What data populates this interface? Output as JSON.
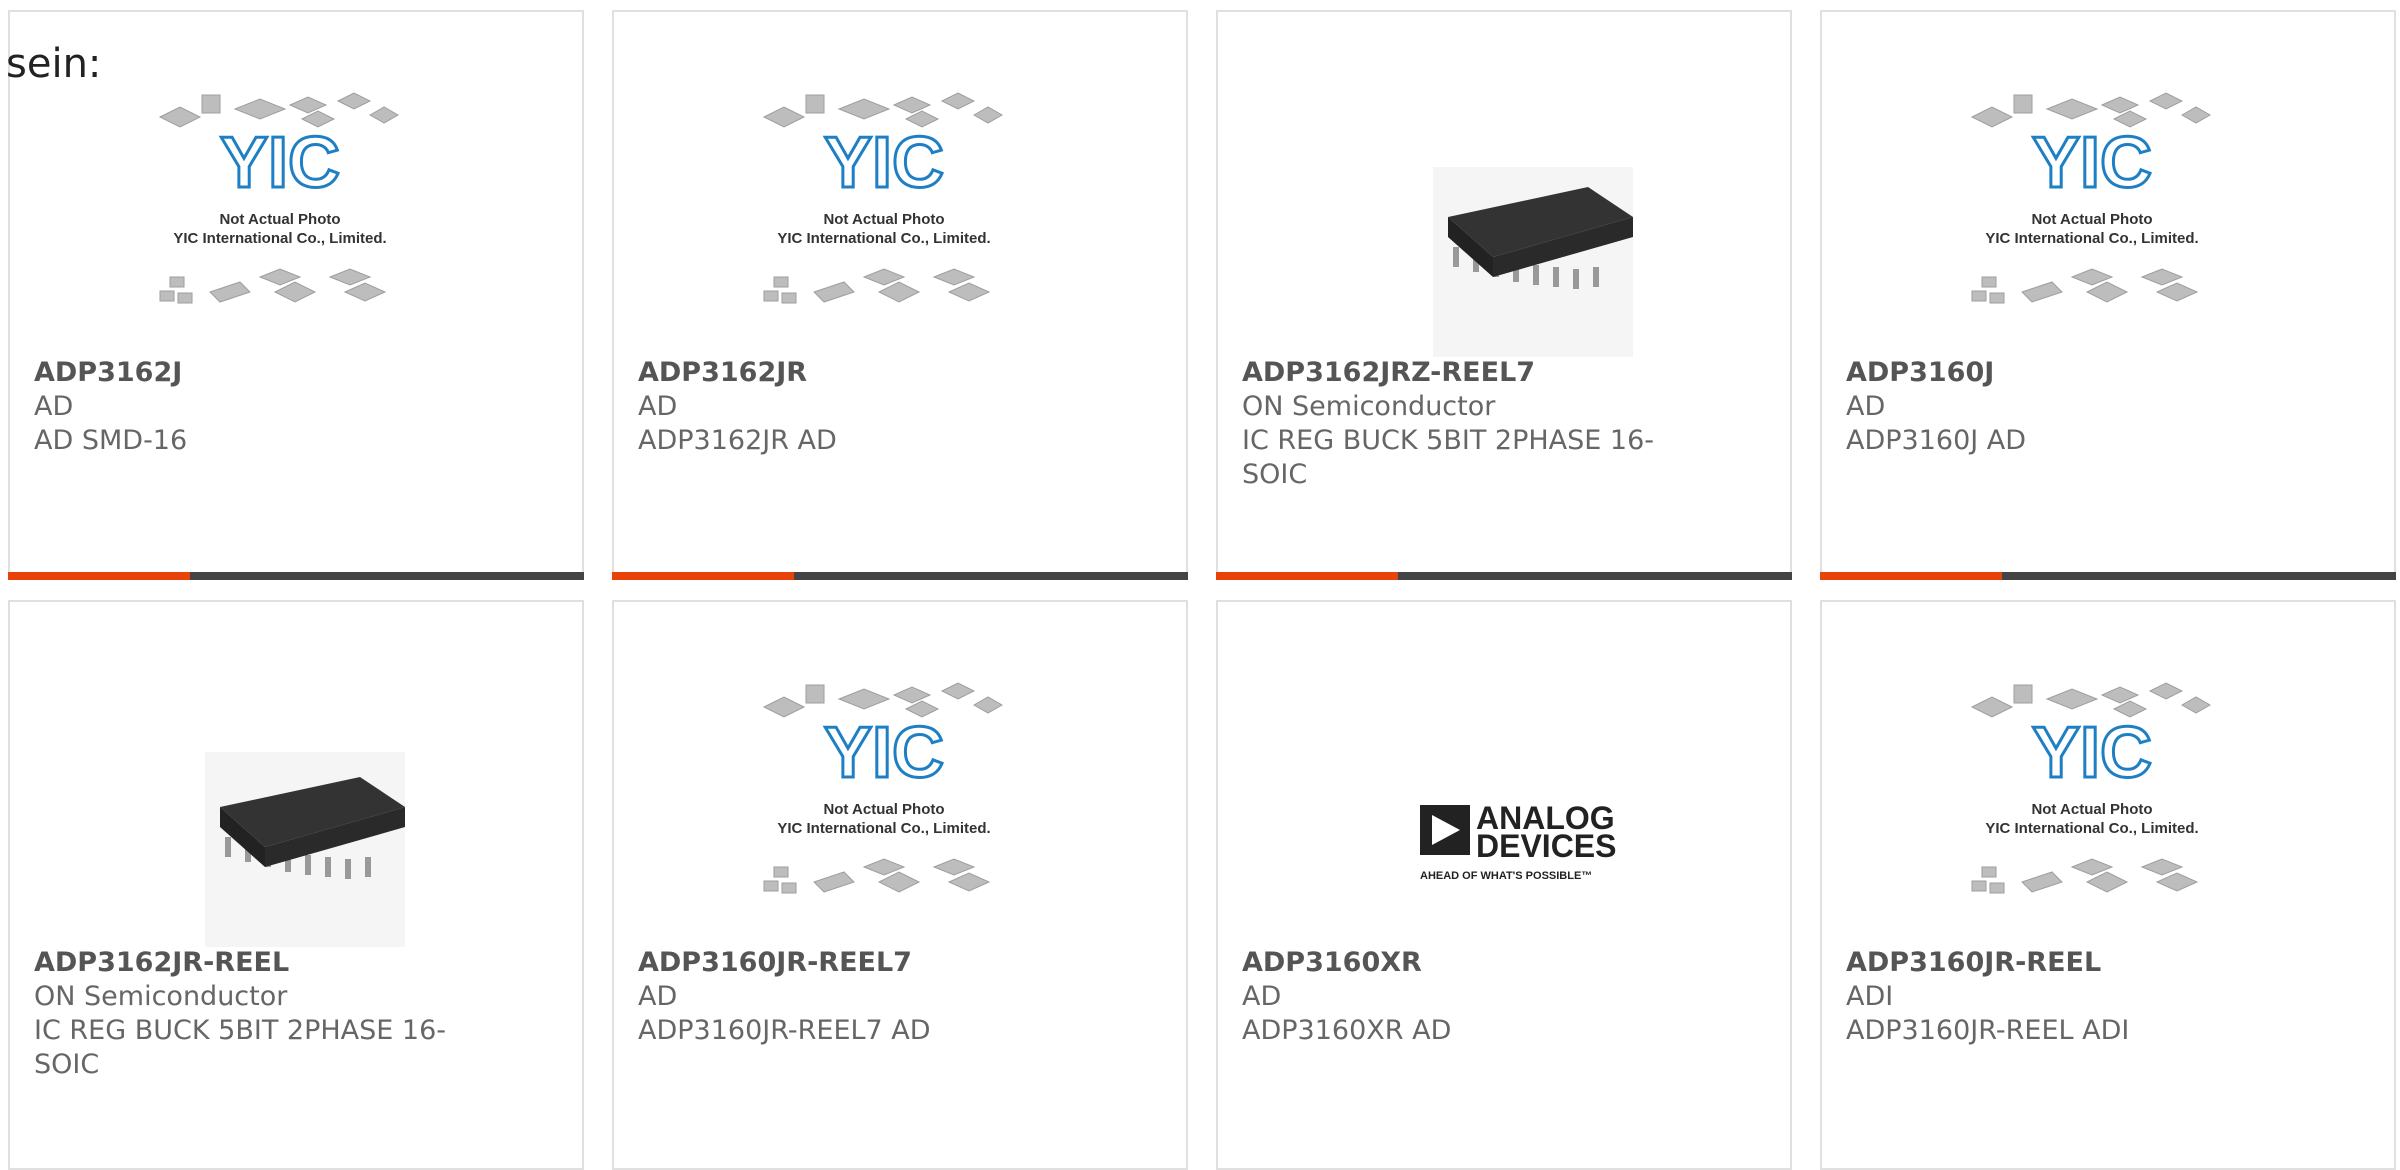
{
  "heading": "sein:",
  "brand": {
    "accent": "#e8410a",
    "bar": "#444444"
  },
  "products": [
    {
      "part_number": "ADP3162J",
      "manufacturer": "AD",
      "description": "AD SMD-16",
      "image": "yic-placeholder-image"
    },
    {
      "part_number": "ADP3162JR",
      "manufacturer": "AD",
      "description": "ADP3162JR AD",
      "image": "yic-placeholder-image"
    },
    {
      "part_number": "ADP3162JRZ-REEL7",
      "manufacturer": "ON Semiconductor",
      "description": "IC REG BUCK 5BIT 2PHASE 16-SOIC",
      "image": "soic-chip-image"
    },
    {
      "part_number": "ADP3160J",
      "manufacturer": "AD",
      "description": "ADP3160J AD",
      "image": "yic-placeholder-image"
    },
    {
      "part_number": "ADP3162JR-REEL",
      "manufacturer": "ON Semiconductor",
      "description": "IC REG BUCK 5BIT 2PHASE 16-SOIC",
      "image": "soic-chip-image"
    },
    {
      "part_number": "ADP3160JR-REEL7",
      "manufacturer": "AD",
      "description": "ADP3160JR-REEL7 AD",
      "image": "yic-placeholder-image"
    },
    {
      "part_number": "ADP3160XR",
      "manufacturer": "AD",
      "description": "ADP3160XR AD",
      "image": "analog-devices-logo"
    },
    {
      "part_number": "ADP3160JR-REEL",
      "manufacturer": "ADI",
      "description": "ADP3160JR-REEL ADI",
      "image": "yic-placeholder-image"
    }
  ],
  "placeholder": {
    "logo_text": "YIC",
    "line1": "Not Actual Photo",
    "line2": "YIC International Co., Limited."
  },
  "adi_logo": {
    "line1": "ANALOG",
    "line2": "DEVICES",
    "tagline": "AHEAD OF WHAT'S POSSIBLE™"
  }
}
